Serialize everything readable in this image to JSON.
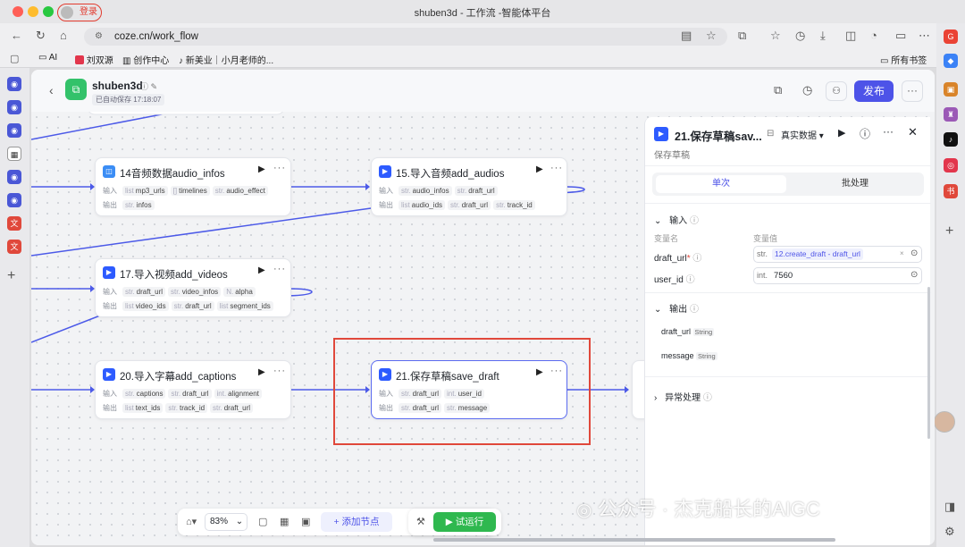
{
  "browser": {
    "title": "shuben3d - 工作流 -智能体平台",
    "login_label": "登录",
    "url": "coze.cn/work_flow",
    "bookmarks": [
      "AI",
      "刘双源",
      "创作中心",
      "新美业｜小月老师的...",
      "所有书签"
    ]
  },
  "header": {
    "project_name": "shuben3d",
    "autosave": "已自动保存 17:18:07",
    "publish_label": "发布"
  },
  "nodes": {
    "n14": {
      "title": "14音频数据audio_infos",
      "in_label": "输入",
      "out_label": "输出",
      "inputs": [
        {
          "t": "list",
          "v": "mp3_urls"
        },
        {
          "t": "[]",
          "v": "timelines"
        },
        {
          "t": "str.",
          "v": "audio_effect"
        }
      ],
      "outputs": [
        {
          "t": "str.",
          "v": "infos"
        }
      ]
    },
    "n15": {
      "title": "15.导入音频add_audios",
      "in_label": "输入",
      "out_label": "输出",
      "inputs": [
        {
          "t": "str.",
          "v": "audio_infos"
        },
        {
          "t": "str.",
          "v": "draft_url"
        }
      ],
      "outputs": [
        {
          "t": "list",
          "v": "audio_ids"
        },
        {
          "t": "str.",
          "v": "draft_url"
        },
        {
          "t": "str.",
          "v": "track_id"
        }
      ]
    },
    "n17": {
      "title": "17.导入视频add_videos",
      "in_label": "输入",
      "out_label": "输出",
      "inputs": [
        {
          "t": "str.",
          "v": "draft_url"
        },
        {
          "t": "str.",
          "v": "video_infos"
        },
        {
          "t": "N.",
          "v": "alpha"
        }
      ],
      "outputs": [
        {
          "t": "list",
          "v": "video_ids"
        },
        {
          "t": "str.",
          "v": "draft_url"
        },
        {
          "t": "list",
          "v": "segment_ids"
        }
      ]
    },
    "n20": {
      "title": "20.导入字幕add_captions",
      "in_label": "输入",
      "out_label": "输出",
      "inputs": [
        {
          "t": "str.",
          "v": "captions"
        },
        {
          "t": "str.",
          "v": "draft_url"
        },
        {
          "t": "int.",
          "v": "alignment"
        }
      ],
      "outputs": [
        {
          "t": "list",
          "v": "text_ids"
        },
        {
          "t": "str.",
          "v": "track_id"
        },
        {
          "t": "str.",
          "v": "draft_url"
        }
      ]
    },
    "n21": {
      "title": "21.保存草稿save_draft",
      "in_label": "输入",
      "out_label": "输出",
      "inputs": [
        {
          "t": "str.",
          "v": "draft_url"
        },
        {
          "t": "int.",
          "v": "user_id"
        }
      ],
      "outputs": [
        {
          "t": "str.",
          "v": "draft_url"
        },
        {
          "t": "str.",
          "v": "message"
        }
      ]
    }
  },
  "panel": {
    "title": "21.保存草稿sav...",
    "subtitle": "保存草稿",
    "data_mode": "真实数据",
    "tab_single": "单次",
    "tab_batch": "批处理",
    "input_section": "输入",
    "col_name": "变量名",
    "col_value": "变量值",
    "params": [
      {
        "name": "draft_url",
        "type": "str.",
        "value": "12.create_draft - draft_url"
      },
      {
        "name": "user_id",
        "type": "int.",
        "value": "7560"
      }
    ],
    "output_section": "输出",
    "outputs": [
      {
        "name": "draft_url",
        "type": "String"
      },
      {
        "name": "message",
        "type": "String"
      }
    ],
    "error_section": "异常处理"
  },
  "toolbar": {
    "zoom": "83%",
    "add_node": "添加节点",
    "run": "试运行"
  },
  "watermark": "公众号 · 杰克船长的AIGC",
  "colors": {
    "accent": "#4d53e8",
    "run_green": "#2fb84f",
    "highlight_red": "#e0483b",
    "edge": "#4c5ae8"
  }
}
